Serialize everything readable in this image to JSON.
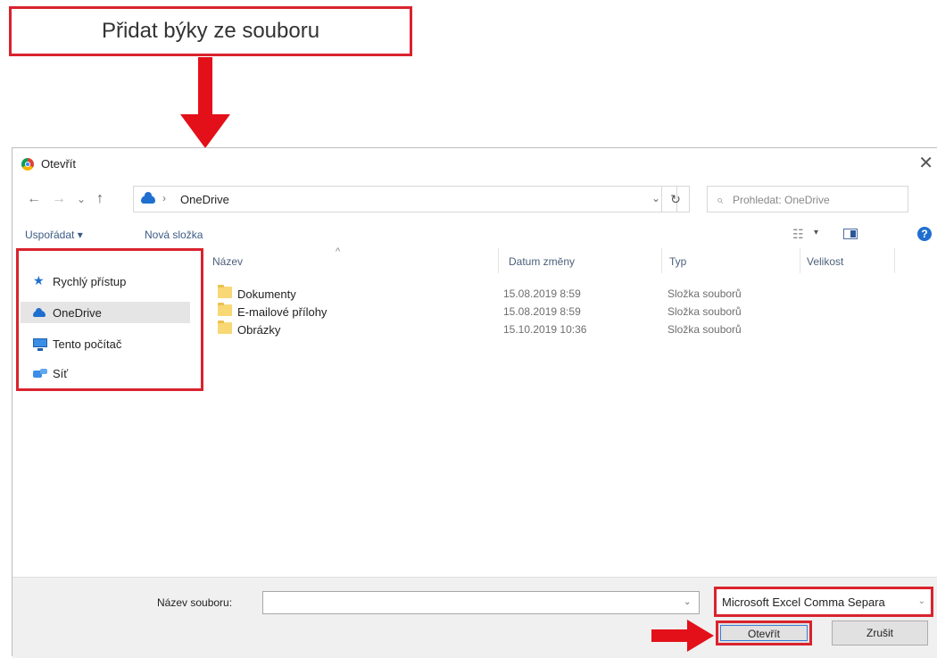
{
  "callout": {
    "label": "Přidat býky ze souboru"
  },
  "dialog": {
    "title": "Otevřít",
    "close": "✕",
    "nav": {
      "back": "←",
      "forward": "→",
      "recent": "⌄",
      "up": "↑"
    },
    "address": {
      "separator": "›",
      "location": "OneDrive",
      "dropdown": "⌄"
    },
    "refresh": "↻",
    "search": {
      "placeholder": "Prohledat: OneDrive",
      "icon": "⌕"
    },
    "toolbar": {
      "organize": "Uspořádat ▾",
      "new_folder": "Nová složka",
      "view": "☷",
      "view_dropdown": "▾",
      "help": "?"
    },
    "navpane": {
      "items": [
        {
          "label": "Rychlý přístup",
          "icon": "star-icon",
          "selected": false
        },
        {
          "label": "OneDrive",
          "icon": "cloud-icon",
          "selected": true
        },
        {
          "label": "Tento počítač",
          "icon": "computer-icon",
          "selected": false
        },
        {
          "label": "Síť",
          "icon": "network-icon",
          "selected": false
        }
      ]
    },
    "columns": {
      "name": "Název",
      "date": "Datum změny",
      "type": "Typ",
      "size": "Velikost",
      "sort_caret": "^"
    },
    "files": [
      {
        "name": "Dokumenty",
        "date": "15.08.2019 8:59",
        "type": "Složka souborů"
      },
      {
        "name": "E-mailové přílohy",
        "date": "15.08.2019 8:59",
        "type": "Složka souborů"
      },
      {
        "name": "Obrázky",
        "date": "15.10.2019 10:36",
        "type": "Složka souborů"
      }
    ],
    "bottom": {
      "filename_label": "Název souboru:",
      "filename_value": "",
      "filename_dropdown": "⌄",
      "filetype": "Microsoft Excel Comma Separa",
      "filetype_dropdown": "⌄",
      "open_button": "Otevřít",
      "cancel_button": "Zrušit"
    }
  },
  "colors": {
    "highlight": "#d9232e",
    "accent": "#1f6fd0"
  }
}
